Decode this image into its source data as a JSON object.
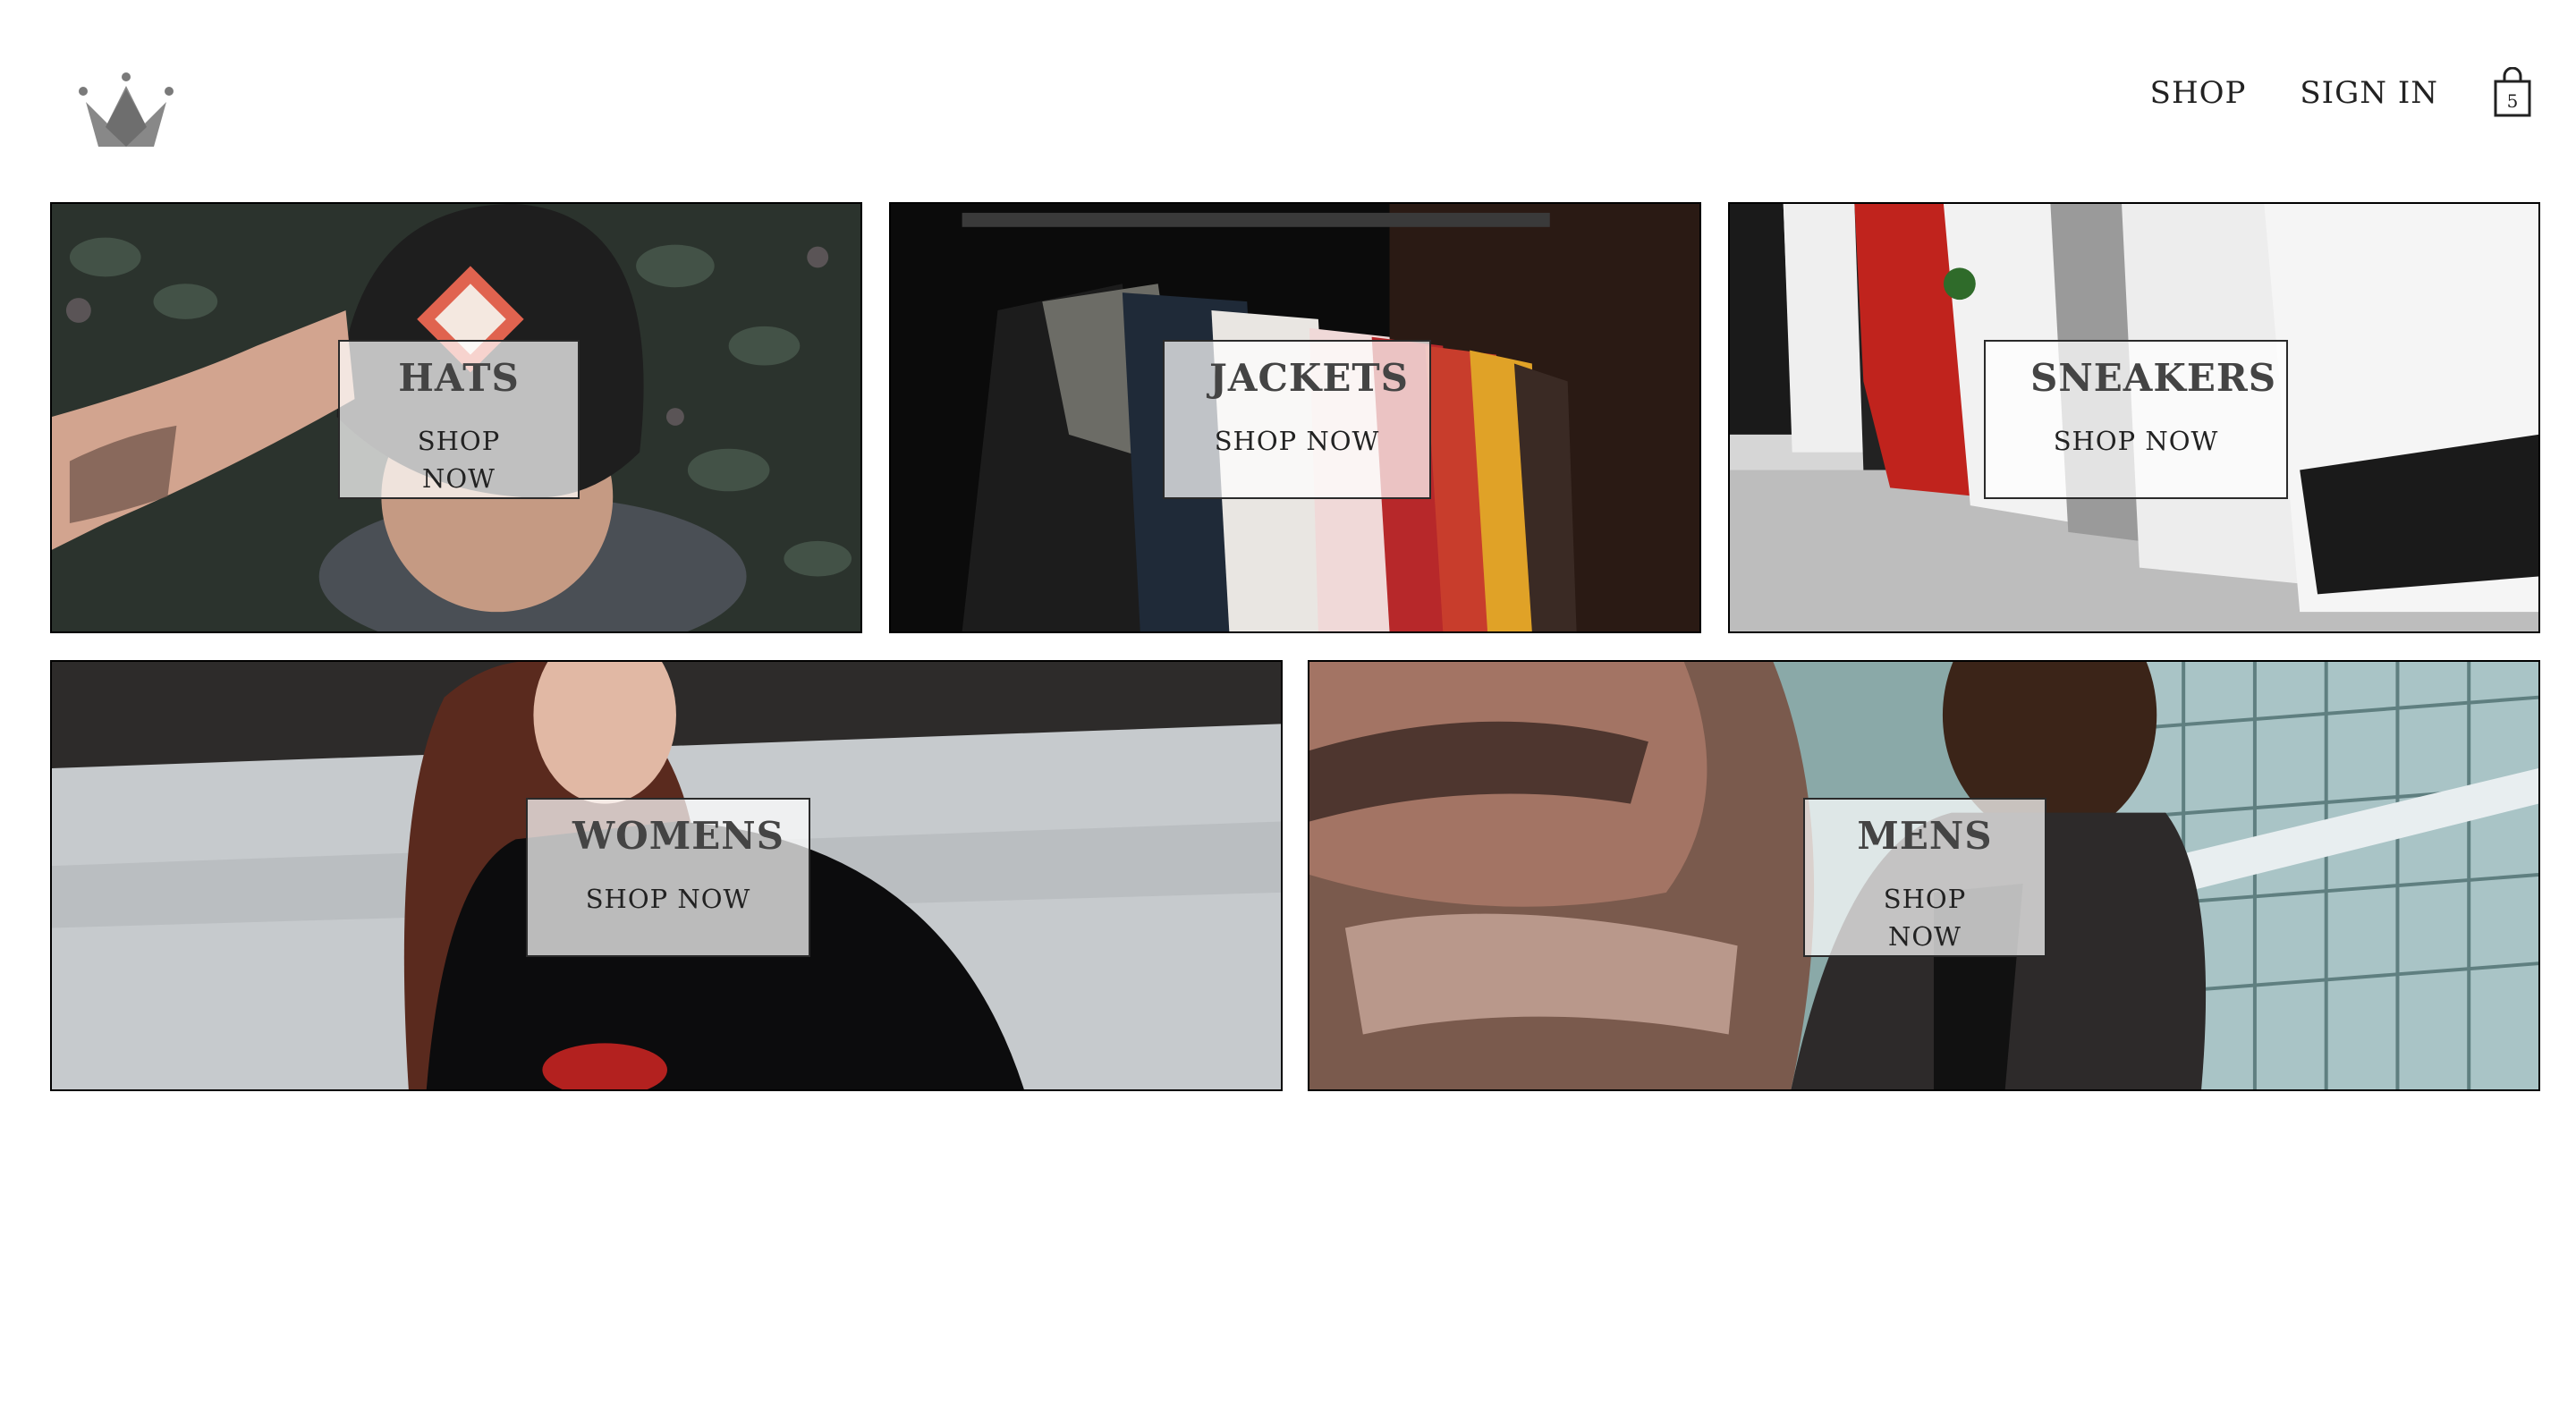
{
  "header": {
    "logo_icon": "crown-icon",
    "nav": {
      "shop_label": "SHOP",
      "sign_in_label": "SIGN IN"
    },
    "cart": {
      "icon": "shopping-bag-icon",
      "count": "5"
    }
  },
  "directory": {
    "items": [
      {
        "title": "HATS",
        "cta": "SHOP NOW"
      },
      {
        "title": "JACKETS",
        "cta": "SHOP NOW"
      },
      {
        "title": "SNEAKERS",
        "cta": "SHOP NOW"
      },
      {
        "title": "WOMENS",
        "cta": "SHOP NOW"
      },
      {
        "title": "MENS",
        "cta": "SHOP NOW"
      }
    ]
  },
  "colors": {
    "text": "#222222",
    "border": "#000000",
    "logo": "#808080",
    "label_bg": "rgba(255,255,255,0.72)"
  }
}
